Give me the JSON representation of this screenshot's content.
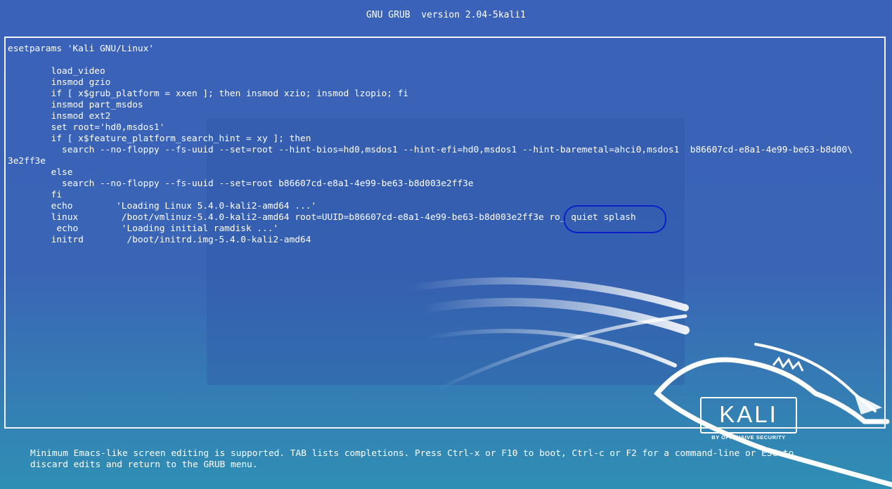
{
  "header": {
    "title": "GNU GRUB  version 2.04-5kali1"
  },
  "editor": {
    "lines": [
      "esetparams 'Kali GNU/Linux'",
      "",
      "        load_video",
      "        insmod gzio",
      "        if [ x$grub_platform = xxen ]; then insmod xzio; insmod lzopio; fi",
      "        insmod part_msdos",
      "        insmod ext2",
      "        set root='hd0,msdos1'",
      "        if [ x$feature_platform_search_hint = xy ]; then",
      "          search --no-floppy --fs-uuid --set=root --hint-bios=hd0,msdos1 --hint-efi=hd0,msdos1 --hint-baremetal=ahci0,msdos1  b86607cd-e8a1-4e99-be63-b8d00\\",
      "3e2ff3e",
      "        else",
      "          search --no-floppy --fs-uuid --set=root b86607cd-e8a1-4e99-be63-b8d003e2ff3e",
      "        fi",
      "        echo        'Loading Linux 5.4.0-kali2-amd64 ...'",
      "        linux        /boot/vmlinuz-5.4.0-kali2-amd64 root=UUID=b86607cd-e8a1-4e99-be63-b8d003e2ff3e ro_ quiet splash",
      "         echo        'Loading initial ramdisk ...'",
      "        initrd        /boot/initrd.img-5.4.0-kali2-amd64"
    ]
  },
  "help": {
    "line1": "Minimum Emacs-like screen editing is supported. TAB lists completions. Press Ctrl-x or F10 to boot, Ctrl-c or F2 for a command-line or ESC to",
    "line2": "discard edits and return to the GRUB menu."
  },
  "logo": {
    "word": "KALI",
    "tagline": "BY OFFENSIVE SECURITY"
  },
  "colors": {
    "background": "#3a62b8",
    "text": "#ffffff",
    "annotation_ellipse": "#0a1fc9"
  }
}
